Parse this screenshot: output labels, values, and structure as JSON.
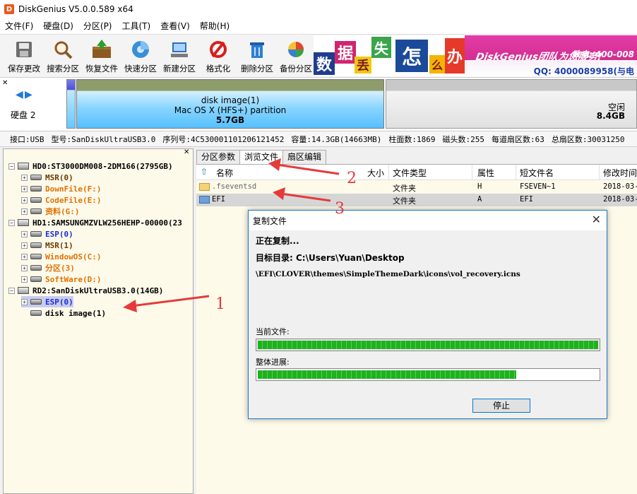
{
  "window": {
    "title": "DiskGenius V5.0.0.589 x64",
    "icon_letter": "D"
  },
  "menu": [
    "文件(F)",
    "硬盘(D)",
    "分区(P)",
    "工具(T)",
    "查看(V)",
    "帮助(H)"
  ],
  "toolbar": [
    {
      "label": "保存更改",
      "icon": "save-icon"
    },
    {
      "label": "搜索分区",
      "icon": "search-icon"
    },
    {
      "label": "恢复文件",
      "icon": "recover-icon"
    },
    {
      "label": "快速分区",
      "icon": "quick-partition-icon"
    },
    {
      "label": "新建分区",
      "icon": "new-partition-icon"
    },
    {
      "label": "格式化",
      "icon": "format-icon"
    },
    {
      "label": "删除分区",
      "icon": "delete-icon"
    },
    {
      "label": "备份分区",
      "icon": "backup-icon"
    }
  ],
  "banner": {
    "chars": [
      "数",
      "据",
      "丢",
      "失",
      "怎",
      "么",
      "办"
    ],
    "slogan": "DiskGenius团队为您服务!",
    "phone": "致电: 400-008",
    "qq": "QQ: 4000089958(与电"
  },
  "diskbar": {
    "label": "硬盘 2",
    "partition": {
      "name": "disk image(1)",
      "fs": "Mac OS X (HFS+) partition",
      "size": "5.7GB"
    },
    "free": {
      "name": "空闲",
      "size": "8.4GB"
    }
  },
  "info": {
    "interface": "接口:USB",
    "model": "型号:SanDiskUltraUSB3.0",
    "serial": "序列号:4C530001101206121452",
    "capacity": "容量:14.3GB(14663MB)",
    "cylinders": "柱面数:1869",
    "heads": "磁头数:255",
    "sectors_per_track": "每道扇区数:63",
    "total_sectors": "总扇区数:30031250"
  },
  "tree": [
    {
      "text": "HD0:ST3000DM008-2DM166(2795GB)",
      "level": 0,
      "type": "disk",
      "color": "#000000"
    },
    {
      "text": "MSR(0)",
      "level": 1,
      "type": "part",
      "color": "#6b3a00"
    },
    {
      "text": "DownFile(F:)",
      "level": 1,
      "type": "part",
      "color": "#e07000"
    },
    {
      "text": "CodeFile(E:)",
      "level": 1,
      "type": "part",
      "color": "#e07000"
    },
    {
      "text": "资料(G:)",
      "level": 1,
      "type": "part",
      "color": "#e07000"
    },
    {
      "text": "HD1:SAMSUNGMZVLW256HEHP-00000(23",
      "level": 0,
      "type": "disk",
      "color": "#000000"
    },
    {
      "text": "ESP(0)",
      "level": 1,
      "type": "part",
      "color": "#1d2bd0"
    },
    {
      "text": "MSR(1)",
      "level": 1,
      "type": "part",
      "color": "#6b3a00"
    },
    {
      "text": "WindowOS(C:)",
      "level": 1,
      "type": "part",
      "color": "#e07000"
    },
    {
      "text": "分区(3)",
      "level": 1,
      "type": "part",
      "color": "#e07000"
    },
    {
      "text": "SoftWare(D:)",
      "level": 1,
      "type": "part",
      "color": "#e07000"
    },
    {
      "text": "RD2:SanDiskUltraUSB3.0(14GB)",
      "level": 0,
      "type": "disk",
      "color": "#000000"
    },
    {
      "text": "ESP(0)",
      "level": 1,
      "type": "part",
      "color": "#1d2bd0"
    },
    {
      "text": "disk image(1)",
      "level": 1,
      "type": "part",
      "color": "#000000"
    }
  ],
  "tabs": [
    "分区参数",
    "浏览文件",
    "扇区编辑"
  ],
  "file_columns": [
    "名称",
    "大小",
    "文件类型",
    "属性",
    "短文件名",
    "修改时间"
  ],
  "files": [
    {
      "name": ".fseventsd",
      "size": "",
      "type": "文件夹",
      "attr": "H",
      "short": "FSEVEN~1",
      "mtime": "2018-03-"
    },
    {
      "name": "EFI",
      "size": "",
      "type": "文件夹",
      "attr": "A",
      "short": "EFI",
      "mtime": "2018-03-"
    }
  ],
  "dialog": {
    "title": "复制文件",
    "status": "正在复制...",
    "target": "目标目录: C:\\Users\\Yuan\\Desktop",
    "path": "\\EFI\\CLOVER\\themes\\SimpleThemeDark\\icons\\vol_recovery.icns",
    "current_label": "当前文件:",
    "total_label": "整体进展:",
    "current_progress": 1.0,
    "total_progress": 0.76,
    "stop": "停止"
  },
  "annotations": [
    "1",
    "2",
    "3"
  ],
  "colors": {
    "accent": "#0078d7",
    "arrow": "#e63a3a",
    "progress": "#20b020"
  }
}
